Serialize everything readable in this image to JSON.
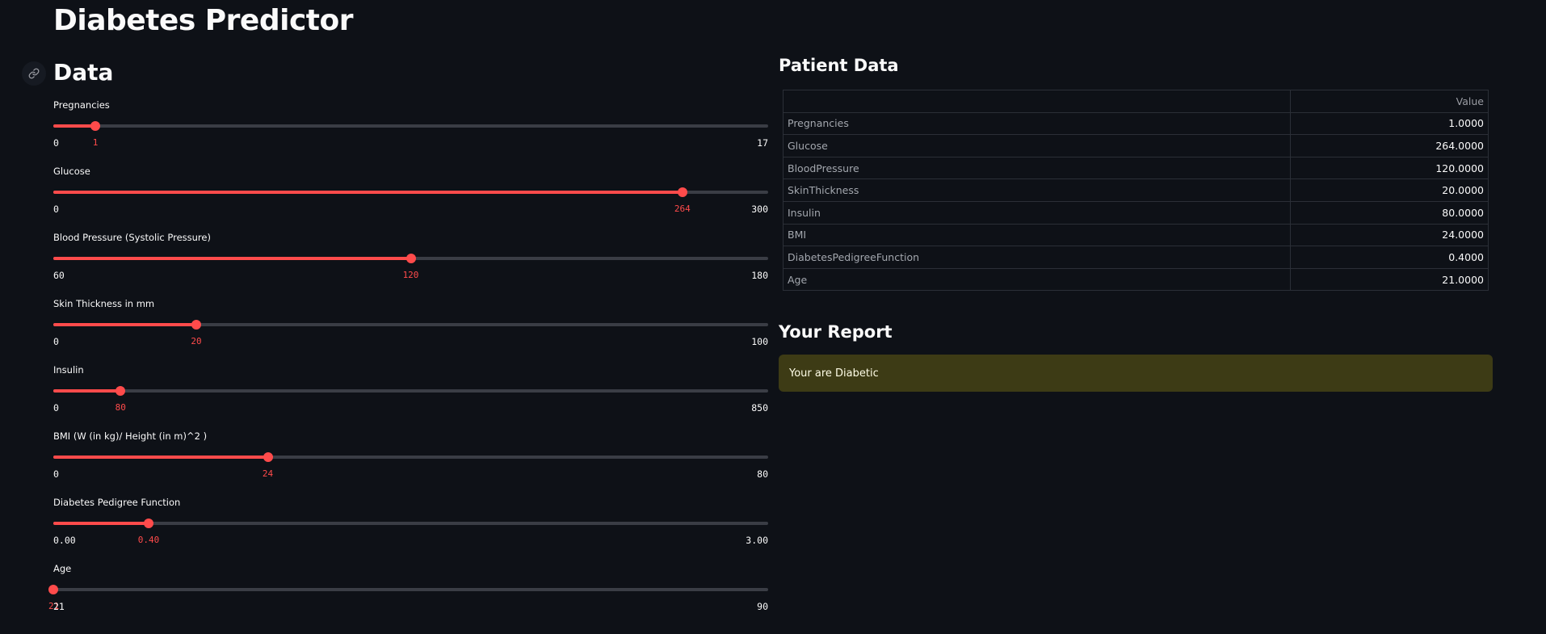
{
  "app": {
    "title": "Diabetes Predictor"
  },
  "sidebar_data": {
    "heading": "Data",
    "sliders": [
      {
        "label": "Pregnancies",
        "value": "1",
        "min": "0",
        "max": "17",
        "fraction": 0.0588
      },
      {
        "label": "Glucose",
        "value": "264",
        "min": "0",
        "max": "300",
        "fraction": 0.88
      },
      {
        "label": "Blood Pressure (Systolic Pressure)",
        "value": "120",
        "min": "60",
        "max": "180",
        "fraction": 0.5
      },
      {
        "label": "Skin Thickness in mm",
        "value": "20",
        "min": "0",
        "max": "100",
        "fraction": 0.2
      },
      {
        "label": "Insulin",
        "value": "80",
        "min": "0",
        "max": "850",
        "fraction": 0.0941
      },
      {
        "label": "BMI (W (in kg)/ Height (in m)^2 )",
        "value": "24",
        "min": "0",
        "max": "80",
        "fraction": 0.3
      },
      {
        "label": "Diabetes Pedigree Function",
        "value": "0.40",
        "min": "0.00",
        "max": "3.00",
        "fraction": 0.1333
      },
      {
        "label": "Age",
        "value": "21",
        "min": "21",
        "max": "90",
        "fraction": 0.0
      }
    ]
  },
  "patient_data": {
    "heading": "Patient Data",
    "column_header": "Value",
    "rows": [
      {
        "name": "Pregnancies",
        "value": "1.0000"
      },
      {
        "name": "Glucose",
        "value": "264.0000"
      },
      {
        "name": "BloodPressure",
        "value": "120.0000"
      },
      {
        "name": "SkinThickness",
        "value": "20.0000"
      },
      {
        "name": "Insulin",
        "value": "80.0000"
      },
      {
        "name": "BMI",
        "value": "24.0000"
      },
      {
        "name": "DiabetesPedigreeFunction",
        "value": "0.4000"
      },
      {
        "name": "Age",
        "value": "21.0000"
      }
    ]
  },
  "report": {
    "heading": "Your Report",
    "message": "Your are Diabetic"
  },
  "icons": {
    "anchor": "link-icon"
  },
  "colors": {
    "background": "#0e1117",
    "accent": "#ff4b4b",
    "warning_bg": "#3d3b15"
  }
}
